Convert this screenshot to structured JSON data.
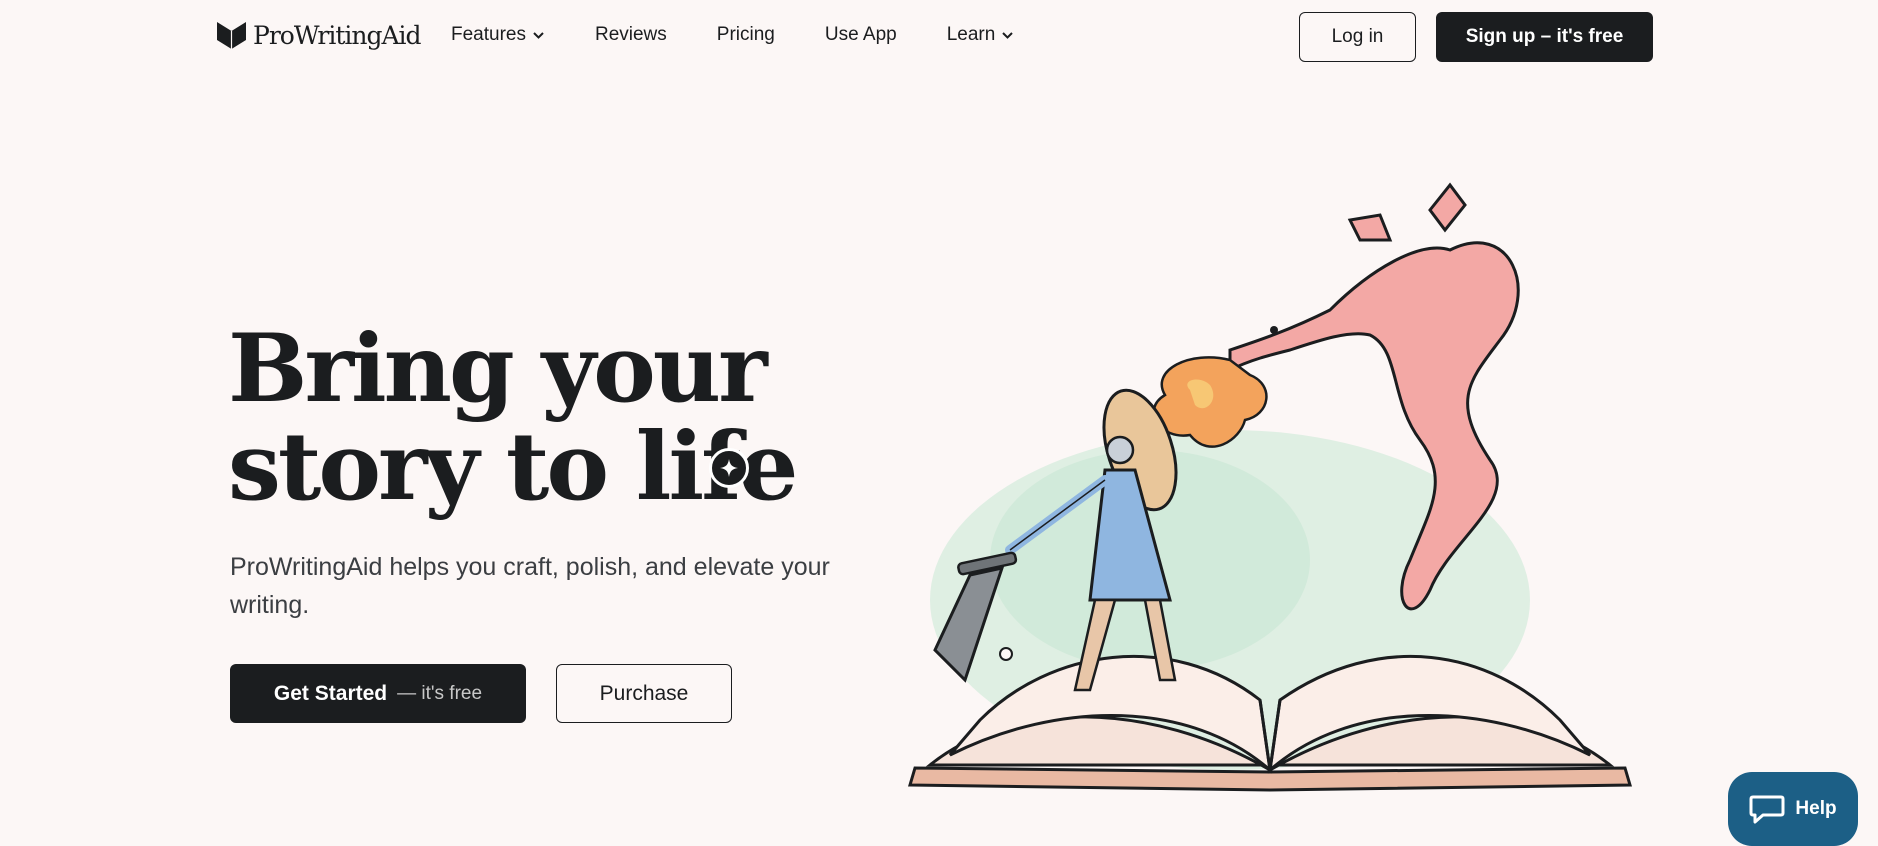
{
  "header": {
    "logo_text": "ProWritingAid",
    "nav": [
      {
        "label": "Features",
        "has_dropdown": true
      },
      {
        "label": "Reviews",
        "has_dropdown": false
      },
      {
        "label": "Pricing",
        "has_dropdown": false
      },
      {
        "label": "Use App",
        "has_dropdown": false
      },
      {
        "label": "Learn",
        "has_dropdown": true
      }
    ],
    "login_label": "Log in",
    "signup_label": "Sign up – it's free"
  },
  "hero": {
    "title_line1": "Bring your",
    "title_line2": "story to life",
    "subtitle": "ProWritingAid helps you craft, polish, and elevate your writing.",
    "cta_primary": "Get Started",
    "cta_primary_sub": "— it's free",
    "cta_secondary": "Purchase",
    "badge_icon": "sparkle-icon"
  },
  "illustration": {
    "description_icon": "dragon-knight-book-illustration"
  },
  "help": {
    "label": "Help",
    "icon": "chat-bubble-icon"
  },
  "colors": {
    "background": "#fcf7f6",
    "primary_dark": "#1b1d1f",
    "help_blue": "#1c5f86",
    "dragon_pink": "#f0a6a3",
    "knight_blue": "#8fb6e0",
    "fire_orange": "#f0a25a",
    "mist_green": "#cfe7d8"
  }
}
